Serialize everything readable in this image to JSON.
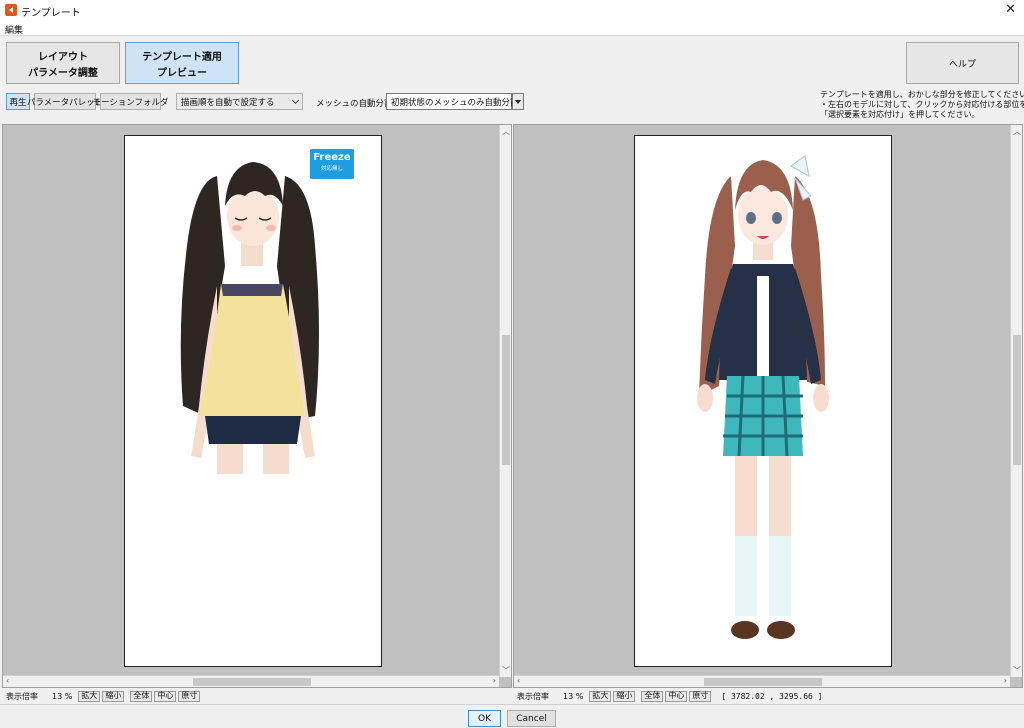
{
  "window": {
    "title": "テンプレート",
    "close": "✕"
  },
  "menu": {
    "items": [
      "編集"
    ]
  },
  "mode_buttons": {
    "layout": [
      "レイアウト",
      "パラメータ調整"
    ],
    "apply": [
      "テンプレート適用",
      "プレビュー"
    ],
    "help": "ヘルプ"
  },
  "toolbar": {
    "play": "再生",
    "param_palette": "パラメータパレット",
    "motion_folder": "モーションフォルダ",
    "draw_order_select": "描画順を自動で設定する",
    "mesh_label": "メッシュの自動分割",
    "mesh_select": "初期状態のメッシュのみ自動分割"
  },
  "instructions": [
    "テンプレートを適用し、おかしな部分を修正してください。",
    "・左右のモデルに対して、クリックから対応付ける部位を選び、",
    "「選択要素を対応付け」を押してください。"
  ],
  "freeze_badge": {
    "title": "Freeze",
    "subtitle": "対応無し"
  },
  "left_status": {
    "zoom_label": "表示倍率",
    "zoom_value": "13 %",
    "buttons": [
      "拡大",
      "縮小",
      "全体",
      "中心",
      "原寸"
    ]
  },
  "right_status": {
    "zoom_label": "表示倍率",
    "zoom_value": "13 %",
    "buttons": [
      "拡大",
      "縮小",
      "全体",
      "中心",
      "原寸"
    ],
    "coords": "[ 3782.02 , 3295.66 ]"
  },
  "dialog": {
    "ok": "OK",
    "cancel": "Cancel"
  },
  "colors": {
    "accent": "#5aa0dd",
    "freeze": "#1e9de0",
    "pane_bg": "#c0c0c0"
  }
}
